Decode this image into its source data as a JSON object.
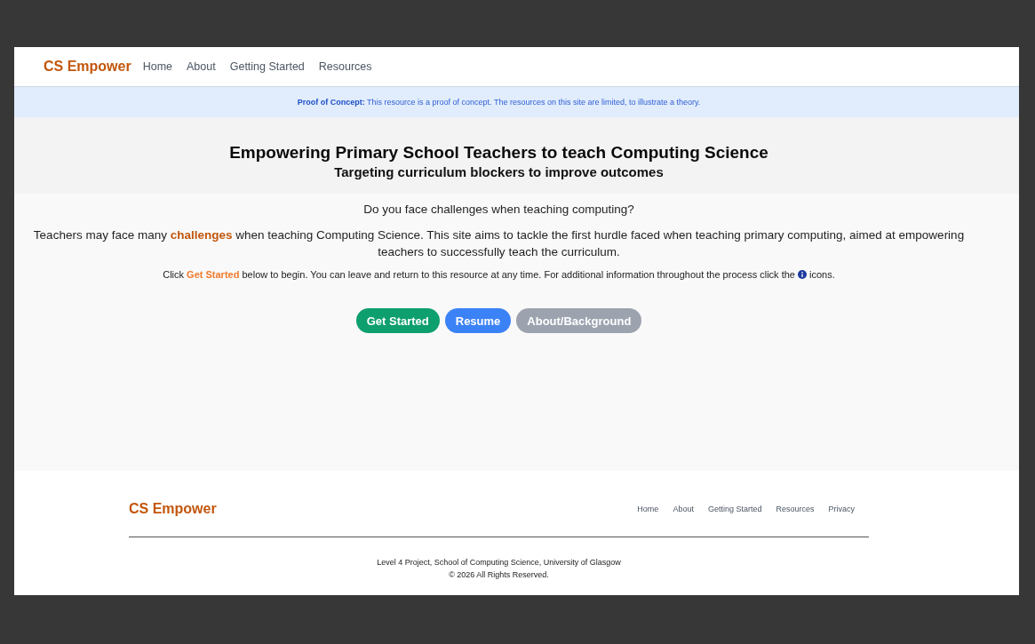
{
  "navbar": {
    "logo": "CS Empower",
    "links": [
      "Home",
      "About",
      "Getting Started",
      "Resources"
    ]
  },
  "banner": {
    "text": "**Proof of Concept:** This resource is a proof of concept. The resources on this site are limited, to illustrate a theory."
  },
  "hero": {
    "title": "Empowering Primary School Teachers to teach Computing Science",
    "subtitle": "Targeting curriculum blockers to improve outcomes"
  },
  "intro": {
    "question": "Do you face challenges when teaching computing?",
    "paragraph": [
      {
        "kind": "text",
        "text": "Teachers may face many "
      },
      {
        "kind": "link",
        "text": "challenges"
      },
      {
        "kind": "text",
        "text": " when teaching Computing Science. This site aims to tackle the first hurdle faced when teaching primary computing, aimed at empowering teachers to successfully teach the curriculum."
      }
    ],
    "instruction": [
      {
        "kind": "text",
        "text": "Click "
      },
      {
        "kind": "highlight",
        "text": "Get Started"
      },
      {
        "kind": "text",
        "text": " below to begin. You can leave and return to this resource at any time. For additional information throughout the process click the "
      },
      {
        "kind": "icon"
      },
      {
        "kind": "text",
        "text": " icons."
      }
    ]
  },
  "buttons": [
    {
      "label": "Get Started",
      "kind": "primary"
    },
    {
      "label": "Resume",
      "kind": "secondary"
    },
    {
      "label": "About/Background",
      "kind": "muted"
    }
  ],
  "footer": {
    "logo": "CS Empower",
    "links": [
      "Home",
      "About",
      "Getting Started",
      "Resources",
      "Privacy"
    ],
    "credits": [
      "Level 4 Project, School of Computing Science, University of Glasgow",
      "© 2026 All Rights Reserved."
    ]
  }
}
